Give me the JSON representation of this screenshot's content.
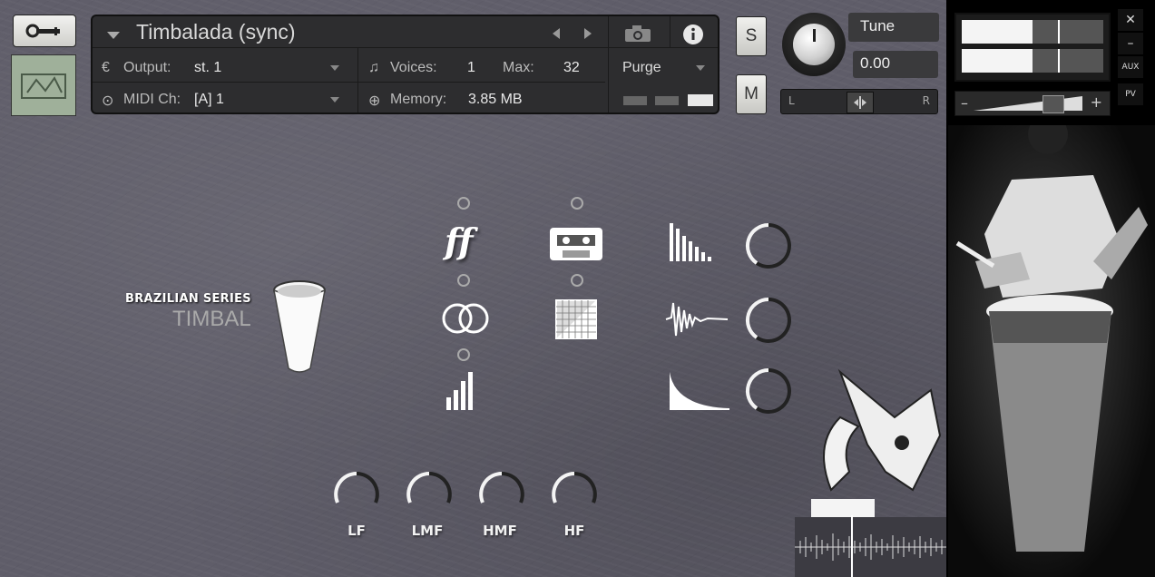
{
  "header": {
    "instrument_name": "Timbalada (sync)",
    "output_label": "Output:",
    "output_value": "st. 1",
    "voices_label": "Voices:",
    "voices_value": "1",
    "max_label": "Max:",
    "max_value": "32",
    "purge_label": "Purge",
    "midi_label": "MIDI Ch:",
    "midi_value": "[A]  1",
    "memory_label": "Memory:",
    "memory_value": "3.85 MB"
  },
  "side_buttons": {
    "solo": "S",
    "mute": "M"
  },
  "tune": {
    "label": "Tune",
    "value": "0.00",
    "pan_left": "L",
    "pan_right": "R"
  },
  "right_panel": {
    "close": "✕",
    "minimize": "–",
    "aux": "AUX",
    "pv": "PV",
    "minus": "–",
    "plus": "+",
    "meter_levels": [
      0.5,
      0.5
    ]
  },
  "brand": {
    "series": "BRAZILIAN SERIES",
    "name": "TIMBAL"
  },
  "controls": {
    "ff_glyph": "ff",
    "eq": [
      "LF",
      "LMF",
      "HMF",
      "HF"
    ]
  },
  "colors": {
    "panel_bg": "#5f5d69",
    "header_bg": "#2d2d2f",
    "accent": "#ffffff"
  }
}
